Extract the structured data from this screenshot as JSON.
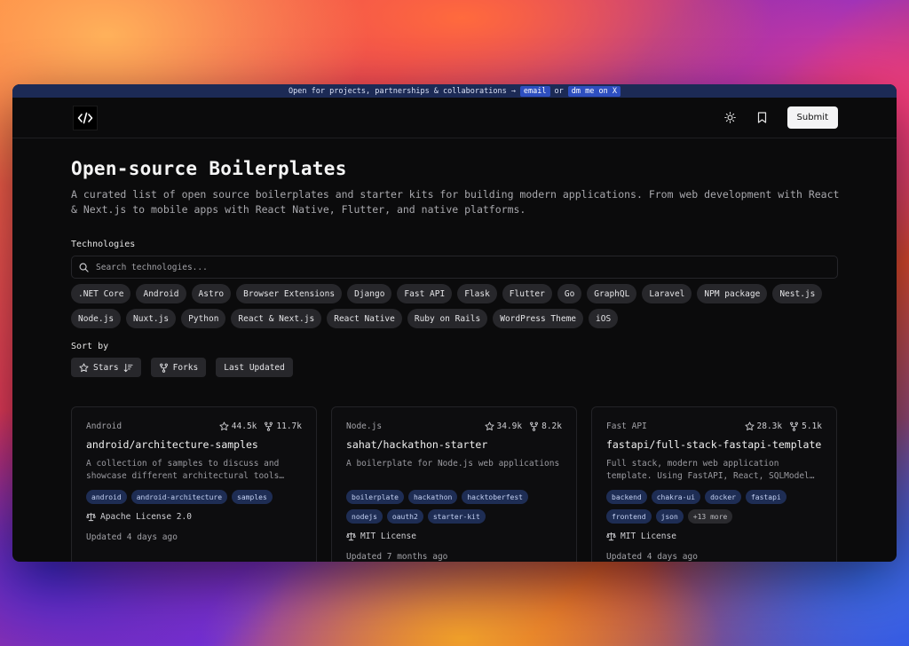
{
  "banner": {
    "text": "Open for projects, partnerships & collaborations →",
    "email_label": "email",
    "or_text": "or",
    "dm_label": "dm me on X"
  },
  "nav": {
    "submit_label": "Submit",
    "icons": [
      "code-logo-icon",
      "sun-icon",
      "bookmark-icon"
    ]
  },
  "page": {
    "title": "Open-source Boilerplates",
    "description": "A curated list of open source boilerplates and starter kits for building modern applications. From web development with React & Next.js to mobile apps with React Native, Flutter, and native platforms."
  },
  "technologies": {
    "label": "Technologies",
    "search_placeholder": "Search technologies...",
    "items": [
      ".NET Core",
      "Android",
      "Astro",
      "Browser Extensions",
      "Django",
      "Fast API",
      "Flask",
      "Flutter",
      "Go",
      "GraphQL",
      "Laravel",
      "NPM package",
      "Nest.js",
      "Node.js",
      "Nuxt.js",
      "Python",
      "React & Next.js",
      "React Native",
      "Ruby on Rails",
      "WordPress Theme",
      "iOS"
    ]
  },
  "sort": {
    "label": "Sort by",
    "options": [
      "Stars",
      "Forks",
      "Last Updated"
    ],
    "active": "Stars"
  },
  "cards": [
    {
      "tech": "Android",
      "stars": "44.5k",
      "forks": "11.7k",
      "name": "android/architecture-samples",
      "description": "A collection of samples to discuss and showcase different architectural tools…",
      "tags": [
        "android",
        "android-architecture",
        "samples"
      ],
      "license": "Apache License 2.0",
      "updated": "Updated 4 days ago"
    },
    {
      "tech": "Node.js",
      "stars": "34.9k",
      "forks": "8.2k",
      "name": "sahat/hackathon-starter",
      "description": "A boilerplate for Node.js web applications",
      "tags": [
        "boilerplate",
        "hackathon",
        "hacktoberfest",
        "nodejs",
        "oauth2",
        "starter-kit"
      ],
      "license": "MIT License",
      "updated": "Updated 7 months ago"
    },
    {
      "tech": "Fast API",
      "stars": "28.3k",
      "forks": "5.1k",
      "name": "fastapi/full-stack-fastapi-template",
      "description": "Full stack, modern web application template. Using FastAPI, React, SQLModel…",
      "tags": [
        "backend",
        "chakra-ui",
        "docker",
        "fastapi",
        "frontend",
        "json"
      ],
      "more_tags": "+13 more",
      "license": "MIT License",
      "updated": "Updated 4 days ago"
    }
  ]
}
